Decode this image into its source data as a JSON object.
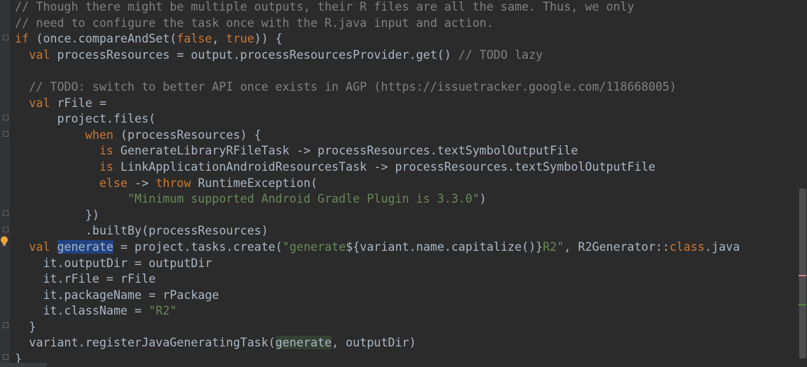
{
  "editor": {
    "lines": [
      {
        "indent": "",
        "tokens": [
          {
            "t": "// Though there might be multiple outputs, their R files are all the same. Thus, we only",
            "c": "cm"
          }
        ]
      },
      {
        "indent": "",
        "tokens": [
          {
            "t": "// need to configure the task once with the R.java input and action.",
            "c": "cm"
          }
        ]
      },
      {
        "indent": "",
        "tokens": [
          {
            "t": "if",
            "c": "kw"
          },
          {
            "t": " (once.compareAndSet("
          },
          {
            "t": "false",
            "c": "kw"
          },
          {
            "t": ", "
          },
          {
            "t": "true",
            "c": "kw"
          },
          {
            "t": ")) {"
          }
        ]
      },
      {
        "indent": "  ",
        "tokens": [
          {
            "t": "val",
            "c": "kw"
          },
          {
            "t": " processResources = output.processResourcesProvider.get() "
          },
          {
            "t": "// TODO lazy",
            "c": "cm"
          }
        ]
      },
      {
        "indent": "",
        "tokens": []
      },
      {
        "indent": "  ",
        "tokens": [
          {
            "t": "// TODO: switch to better API once exists in AGP (https://issuetracker.google.com/118668005)",
            "c": "cm"
          }
        ]
      },
      {
        "indent": "  ",
        "tokens": [
          {
            "t": "val",
            "c": "kw"
          },
          {
            "t": " rFile ="
          }
        ]
      },
      {
        "indent": "      ",
        "tokens": [
          {
            "t": "project.files("
          }
        ]
      },
      {
        "indent": "          ",
        "tokens": [
          {
            "t": "when",
            "c": "kw"
          },
          {
            "t": " (processResources) {"
          }
        ]
      },
      {
        "indent": "            ",
        "tokens": [
          {
            "t": "is",
            "c": "kw"
          },
          {
            "t": " GenerateLibraryRFileTask -> processResources.textSymbolOutputFile"
          }
        ]
      },
      {
        "indent": "            ",
        "tokens": [
          {
            "t": "is",
            "c": "kw"
          },
          {
            "t": " LinkApplicationAndroidResourcesTask -> processResources.textSymbolOutputFile"
          }
        ]
      },
      {
        "indent": "            ",
        "tokens": [
          {
            "t": "else",
            "c": "kw"
          },
          {
            "t": " -> "
          },
          {
            "t": "throw",
            "c": "kw"
          },
          {
            "t": " RuntimeException("
          }
        ]
      },
      {
        "indent": "                ",
        "tokens": [
          {
            "t": "\"Minimum supported Android Gradle Plugin is 3.3.0\"",
            "c": "str"
          },
          {
            "t": ")"
          }
        ]
      },
      {
        "indent": "          ",
        "tokens": [
          {
            "t": "})"
          }
        ]
      },
      {
        "indent": "          ",
        "tokens": [
          {
            "t": ".builtBy(processResources)"
          }
        ]
      },
      {
        "indent": "  ",
        "tokens": [
          {
            "t": "val",
            "c": "kw"
          },
          {
            "t": " "
          },
          {
            "t": "generate",
            "c": "sel"
          },
          {
            "t": " = project.tasks.create("
          },
          {
            "t": "\"generate",
            "c": "str"
          },
          {
            "t": "${variant.name.capitalize()}"
          },
          {
            "t": "R2\"",
            "c": "str"
          },
          {
            "t": ", R2Generator::"
          },
          {
            "t": "class",
            "c": "kw"
          },
          {
            "t": ".java"
          }
        ]
      },
      {
        "indent": "    ",
        "tokens": [
          {
            "t": "it.outputDir = outputDir"
          }
        ]
      },
      {
        "indent": "    ",
        "tokens": [
          {
            "t": "it.rFile = rFile"
          }
        ]
      },
      {
        "indent": "    ",
        "tokens": [
          {
            "t": "it.packageName = rPackage"
          }
        ]
      },
      {
        "indent": "    ",
        "tokens": [
          {
            "t": "it.className = "
          },
          {
            "t": "\"R2\"",
            "c": "str"
          }
        ]
      },
      {
        "indent": "  ",
        "tokens": [
          {
            "t": "}"
          }
        ]
      },
      {
        "indent": "  ",
        "tokens": [
          {
            "t": "variant.registerJavaGeneratingTask("
          },
          {
            "t": "generate",
            "c": "use"
          },
          {
            "t": ", outputDir)"
          }
        ]
      },
      {
        "indent": "",
        "tokens": [
          {
            "t": "}"
          }
        ]
      }
    ]
  },
  "colors": {
    "background": "#2b2b2b",
    "default_text": "#a9b7c6",
    "keyword": "#cc7832",
    "comment": "#808080",
    "string": "#6a8759",
    "selection": "#214283",
    "usage_highlight": "#344134",
    "warning_bulb": "#f0a732"
  },
  "icons": {
    "intention": "lightbulb-icon",
    "fold": "fold-marker-icon"
  }
}
